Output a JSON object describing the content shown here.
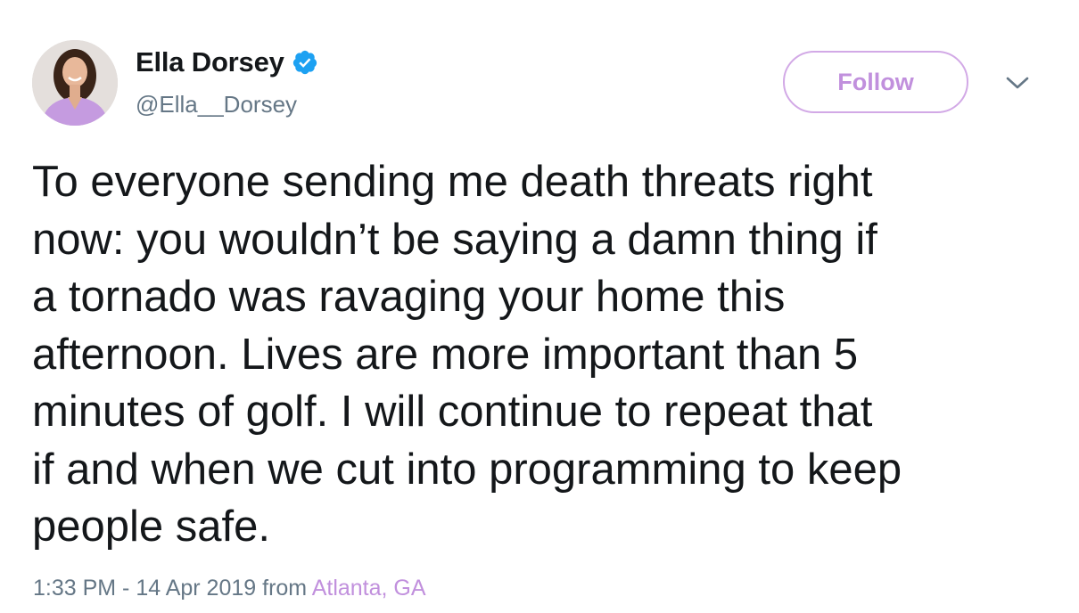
{
  "user": {
    "display_name": "Ella Dorsey",
    "handle": "@Ella__Dorsey",
    "verified": true
  },
  "actions": {
    "follow_label": "Follow",
    "menu_icon": "chevron-down-icon"
  },
  "tweet": {
    "text": "To everyone sending me death threats right\nnow: you wouldn’t be saying a damn thing if\na tornado was ravaging your home this\nafternoon. Lives are more important than 5\nminutes of golf. I will continue to repeat that\nif and when we cut into programming to keep\npeople safe.",
    "timestamp": "1:33 PM - 14 Apr 2019",
    "from_label": "from",
    "location": "Atlanta, GA"
  },
  "colors": {
    "accent": "#c190dd",
    "verified_badge": "#1da1f2",
    "secondary_text": "#657786",
    "primary_text": "#14171a"
  }
}
